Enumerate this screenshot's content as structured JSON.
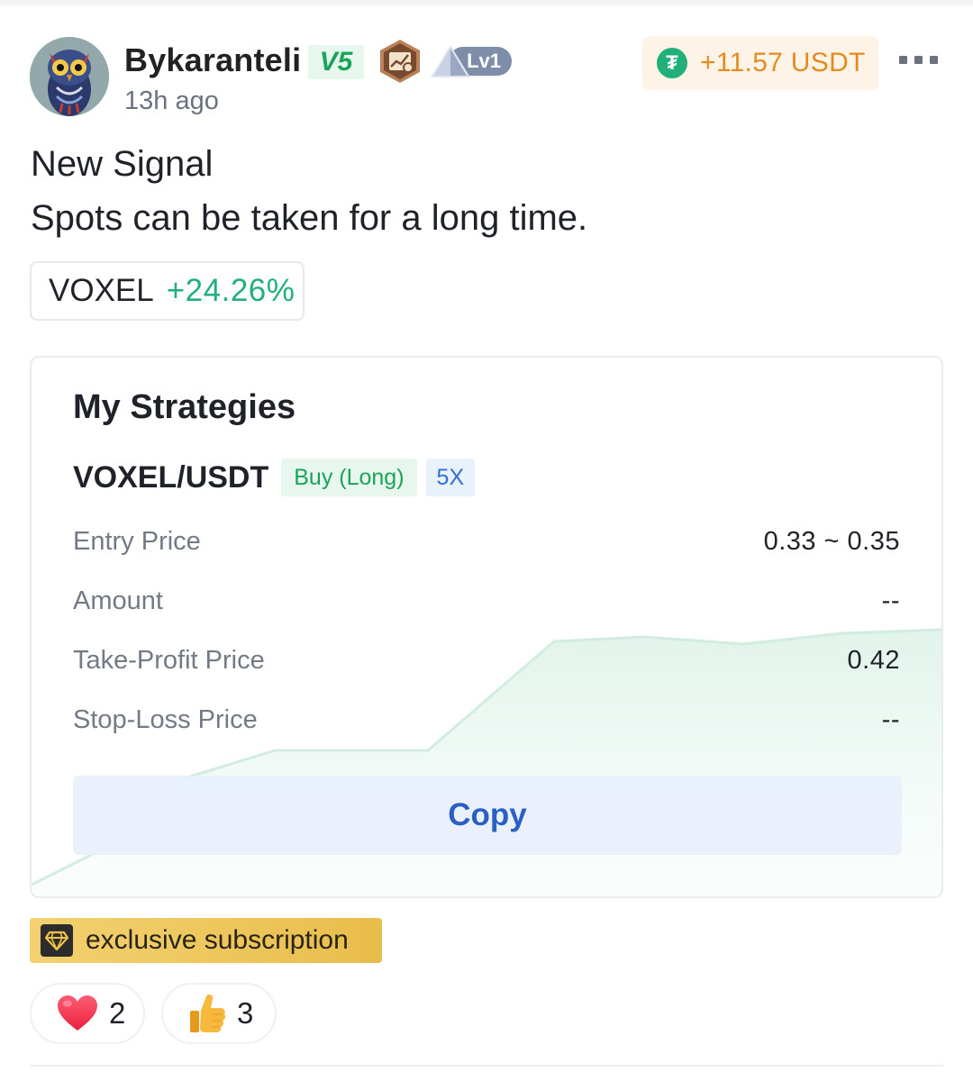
{
  "post": {
    "author": {
      "name": "Bykaranteli",
      "vip_level": "V5",
      "level_badge": "Lv1",
      "avatar_icon": "owl-avatar-icon"
    },
    "time_ago": "13h ago",
    "earnings": "+11.57 USDT",
    "title": "New Signal",
    "body": "Spots can be taken for a long time.",
    "ticker": {
      "symbol": "VOXEL",
      "change": "+24.26%"
    }
  },
  "strategy": {
    "title": "My Strategies",
    "pair": "VOXEL/USDT",
    "side": "Buy (Long)",
    "leverage": "5X",
    "rows": [
      {
        "label": "Entry Price",
        "value": "0.33 ~ 0.35"
      },
      {
        "label": "Amount",
        "value": "--"
      },
      {
        "label": "Take-Profit Price",
        "value": "0.42"
      },
      {
        "label": "Stop-Loss Price",
        "value": "--"
      }
    ],
    "copy_label": "Copy"
  },
  "subscription": {
    "label": "exclusive subscription"
  },
  "reactions": [
    {
      "icon": "heart-icon",
      "count": "2"
    },
    {
      "icon": "thumbs-up-icon",
      "count": "3"
    }
  ],
  "colors": {
    "positive": "#21b07a",
    "earn": "#e48a1f",
    "copy_text": "#2b5fc4",
    "gold": "#e9bd4c"
  }
}
